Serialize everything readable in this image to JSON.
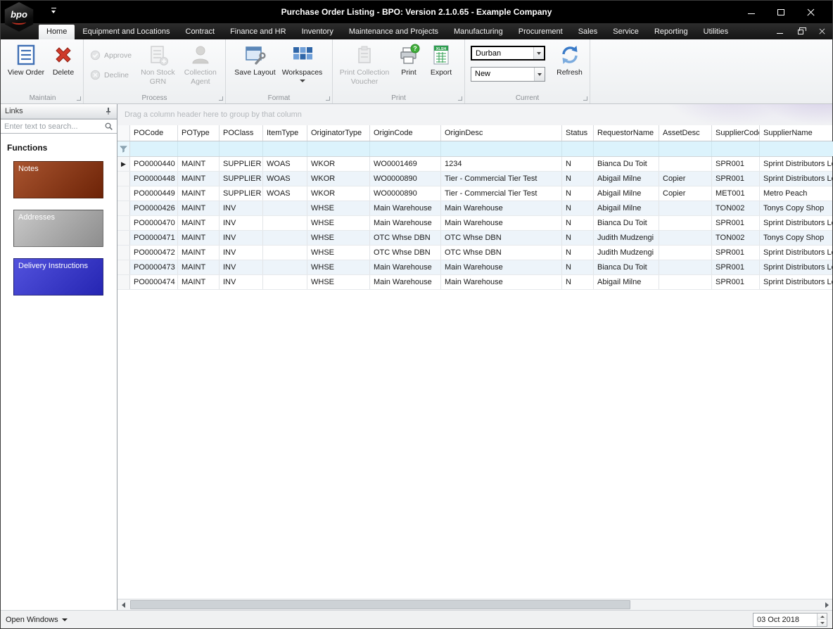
{
  "window": {
    "title": "Purchase Order Listing - BPO: Version 2.1.0.65 - Example Company",
    "logo_text": "bpo"
  },
  "tabs": [
    {
      "label": "Home",
      "active": true
    },
    {
      "label": "Equipment and Locations",
      "active": false
    },
    {
      "label": "Contract",
      "active": false
    },
    {
      "label": "Finance and HR",
      "active": false
    },
    {
      "label": "Inventory",
      "active": false
    },
    {
      "label": "Maintenance and Projects",
      "active": false
    },
    {
      "label": "Manufacturing",
      "active": false
    },
    {
      "label": "Procurement",
      "active": false
    },
    {
      "label": "Sales",
      "active": false
    },
    {
      "label": "Service",
      "active": false
    },
    {
      "label": "Reporting",
      "active": false
    },
    {
      "label": "Utilities",
      "active": false
    }
  ],
  "ribbon": {
    "maintain": {
      "label": "Maintain",
      "view_order": "View Order",
      "delete": "Delete"
    },
    "process": {
      "label": "Process",
      "approve": "Approve",
      "decline": "Decline",
      "non_stock_grn": "Non Stock GRN",
      "collection_agent": "Collection Agent"
    },
    "format": {
      "label": "Format",
      "save_layout": "Save Layout",
      "workspaces": "Workspaces"
    },
    "print": {
      "label": "Print",
      "print_collection_voucher": "Print Collection Voucher",
      "print": "Print",
      "export": "Export"
    },
    "current": {
      "label": "Current",
      "site_value": "Durban",
      "status_value": "New",
      "refresh": "Refresh"
    }
  },
  "sidebar": {
    "links_title": "Links",
    "search_placeholder": "Enter text to search...",
    "functions_title": "Functions",
    "functions": [
      {
        "label": "Notes",
        "color_light": "#a8542f",
        "color_dark": "#6d2307"
      },
      {
        "label": "Addresses",
        "color_light": "#c9c9c9",
        "color_dark": "#8d8d8d"
      },
      {
        "label": "Delivery Instructions",
        "color_light": "#5252dd",
        "color_dark": "#2525b2"
      }
    ]
  },
  "grid": {
    "group_hint": "Drag a column header here to group by that column",
    "columns": [
      "POCode",
      "POType",
      "POClass",
      "ItemType",
      "OriginatorType",
      "OriginCode",
      "OriginDesc",
      "Status",
      "RequestorName",
      "AssetDesc",
      "SupplierCode",
      "SupplierName"
    ],
    "selected_row": 0,
    "rows": [
      [
        "PO0000440",
        "MAINT",
        "SUPPLIER",
        "WOAS",
        "WKOR",
        "WO0001469",
        "1234",
        "N",
        "Bianca Du Toit",
        "",
        "SPR001",
        "Sprint Distributors Lo"
      ],
      [
        "PO0000448",
        "MAINT",
        "SUPPLIER",
        "WOAS",
        "WKOR",
        "WO0000890",
        "Tier - Commercial Tier Test",
        "N",
        "Abigail Milne",
        "Copier",
        "SPR001",
        "Sprint Distributors Lo"
      ],
      [
        "PO0000449",
        "MAINT",
        "SUPPLIER",
        "WOAS",
        "WKOR",
        "WO0000890",
        "Tier - Commercial Tier Test",
        "N",
        "Abigail Milne",
        "Copier",
        "MET001",
        "Metro Peach"
      ],
      [
        "PO0000426",
        "MAINT",
        "INV",
        "",
        "WHSE",
        "Main Warehouse",
        "Main Warehouse",
        "N",
        "Abigail Milne",
        "",
        "TON002",
        "Tonys Copy Shop"
      ],
      [
        "PO0000470",
        "MAINT",
        "INV",
        "",
        "WHSE",
        "Main Warehouse",
        "Main Warehouse",
        "N",
        "Bianca Du Toit",
        "",
        "SPR001",
        "Sprint Distributors Lo"
      ],
      [
        "PO0000471",
        "MAINT",
        "INV",
        "",
        "WHSE",
        "OTC Whse DBN",
        "OTC Whse DBN",
        "N",
        "Judith Mudzengi",
        "",
        "TON002",
        "Tonys Copy Shop"
      ],
      [
        "PO0000472",
        "MAINT",
        "INV",
        "",
        "WHSE",
        "OTC Whse DBN",
        "OTC Whse DBN",
        "N",
        "Judith Mudzengi",
        "",
        "SPR001",
        "Sprint Distributors Lo"
      ],
      [
        "PO0000473",
        "MAINT",
        "INV",
        "",
        "WHSE",
        "Main Warehouse",
        "Main Warehouse",
        "N",
        "Bianca Du Toit",
        "",
        "SPR001",
        "Sprint Distributors Lo"
      ],
      [
        "PO0000474",
        "MAINT",
        "INV",
        "",
        "WHSE",
        "Main Warehouse",
        "Main Warehouse",
        "N",
        "Abigail Milne",
        "",
        "SPR001",
        "Sprint Distributors Lo"
      ]
    ]
  },
  "statusbar": {
    "open_windows": "Open Windows",
    "date": "03 Oct 2018"
  }
}
